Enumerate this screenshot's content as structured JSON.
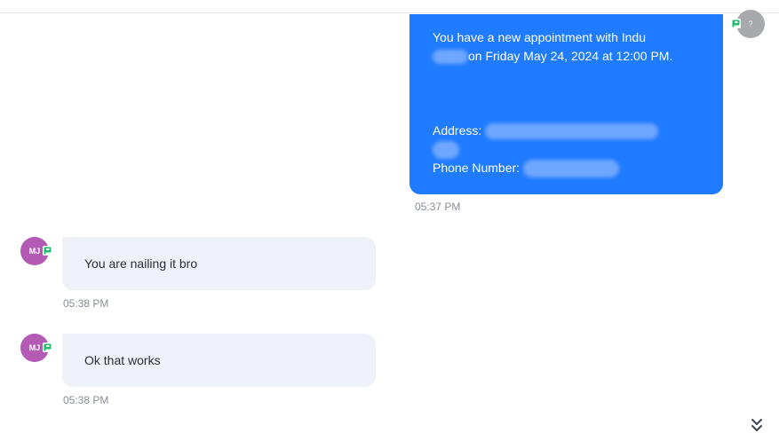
{
  "outgoing": {
    "line1": "You have a new appointment with Indu",
    "line2": "on Friday May 24, 2024  at 12:00 PM.",
    "address_label": "Address:",
    "phone_label": "Phone Number:",
    "time": "05:37 PM",
    "avatar_initials": "?",
    "bubble_color": "#1f7bff"
  },
  "incoming": [
    {
      "initials": "MJ",
      "text": "You are nailing it bro",
      "time": "05:38 PM"
    },
    {
      "initials": "MJ",
      "text": "Ok that works",
      "time": "05:38 PM"
    }
  ],
  "colors": {
    "avatar_mj": "#b35ab5",
    "channel_badge": "#1fbf6a"
  },
  "icons": {
    "channel": "chat-flag-icon",
    "scroll": "double-chevron-down-icon"
  }
}
